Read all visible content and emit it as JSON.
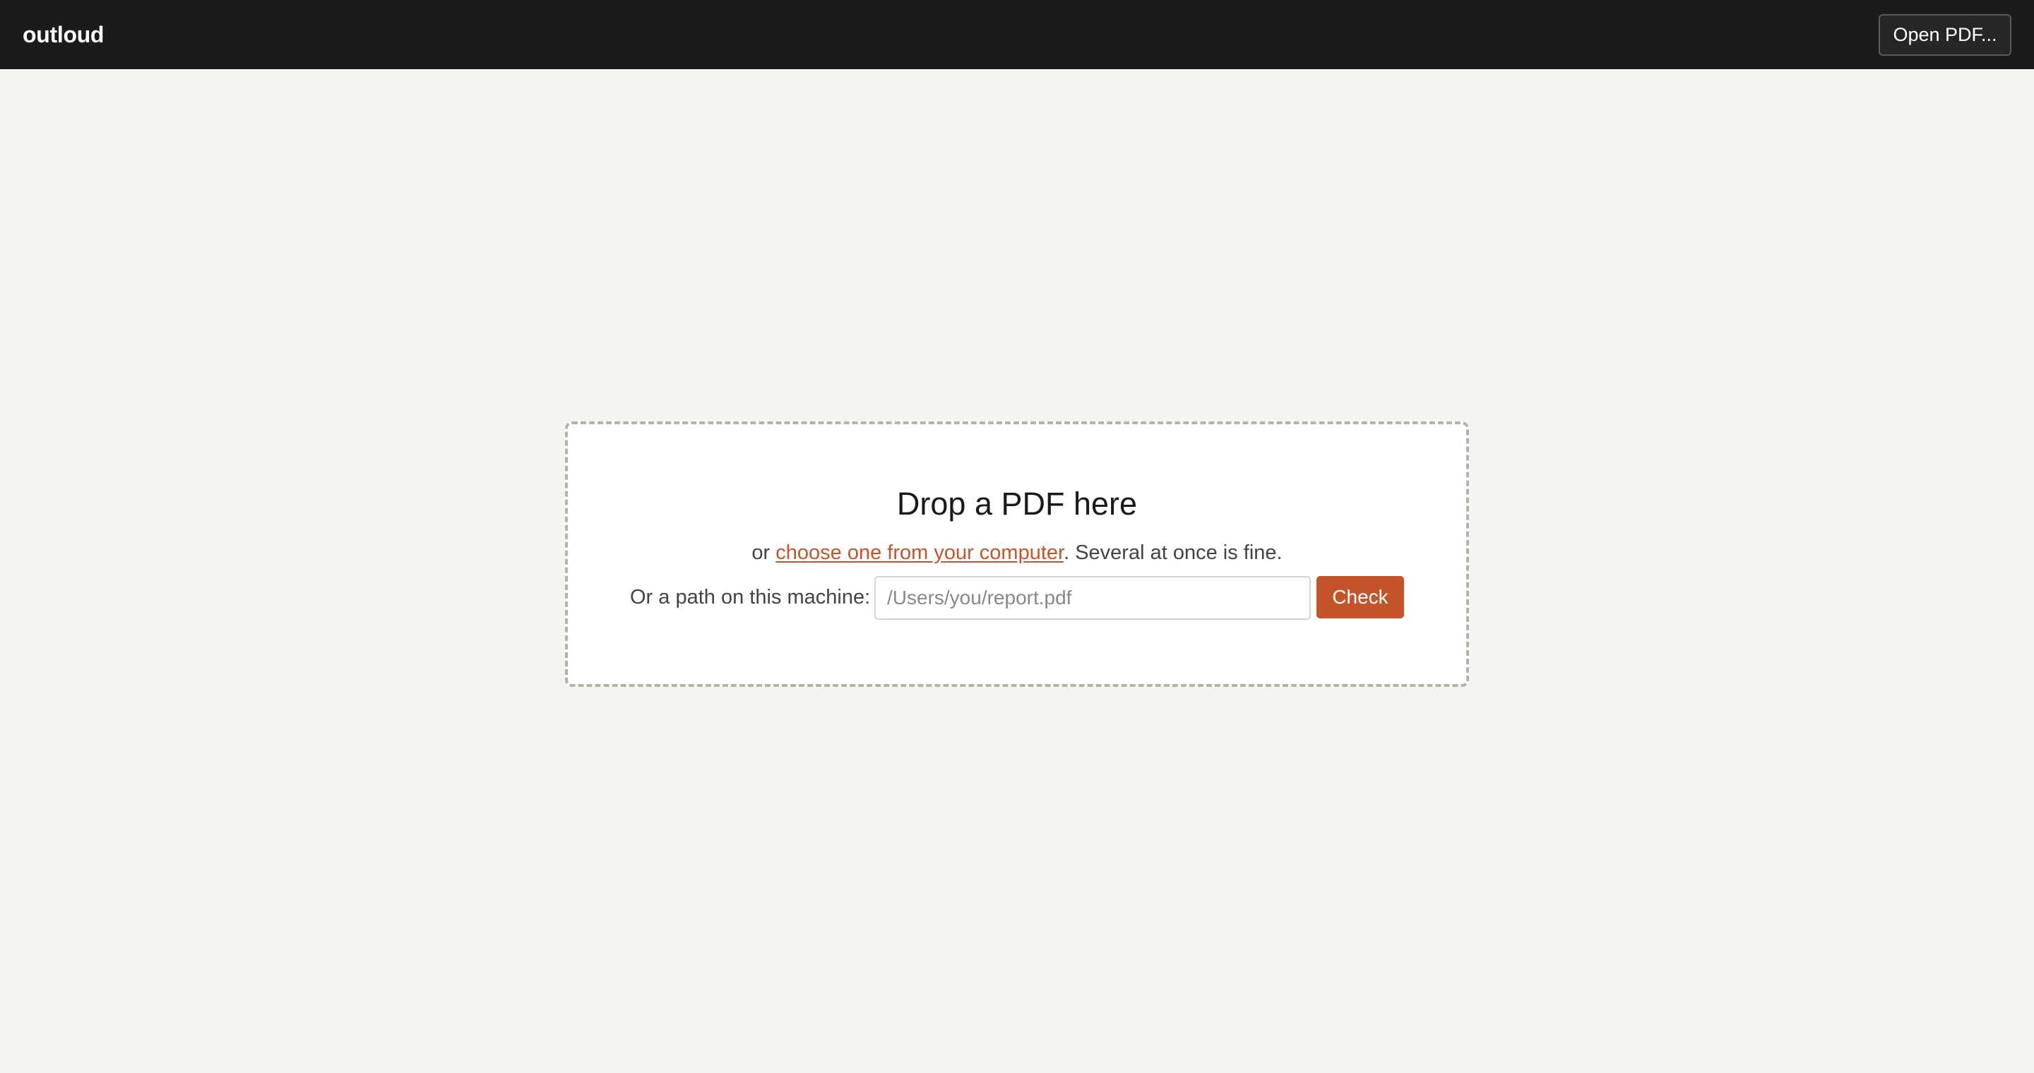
{
  "header": {
    "brand": "outloud",
    "open_button_label": "Open PDF..."
  },
  "dropzone": {
    "title": "Drop a PDF here",
    "sub_prefix": "or ",
    "choose_link": "choose one from your computer",
    "sub_suffix": ". Several at once is fine.",
    "path_label": "Or a path on this machine:",
    "path_placeholder": "/Users/you/report.pdf",
    "path_value": "",
    "check_label": "Check"
  },
  "colors": {
    "topbar_bg": "#1b1b1b",
    "page_bg": "#f5f4ef",
    "accent": "#c4552a"
  }
}
